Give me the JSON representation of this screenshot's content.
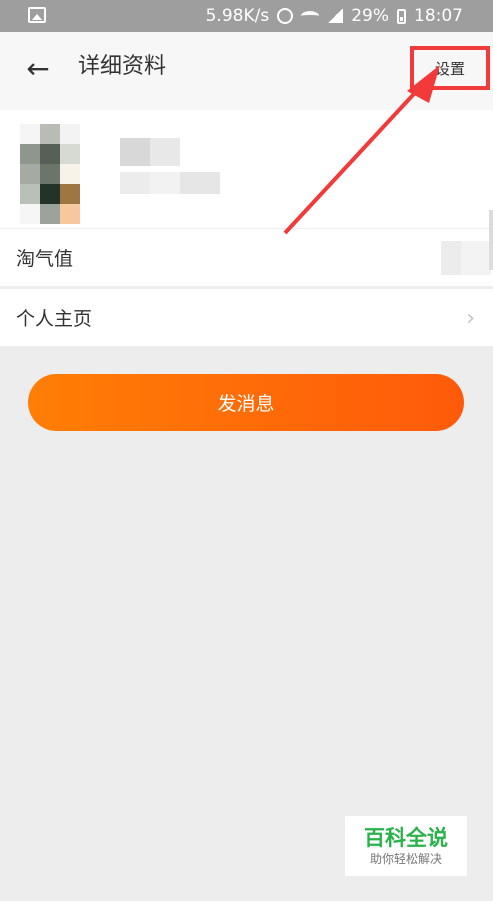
{
  "status_bar": {
    "speed": "5.98K/s",
    "battery": "29%",
    "time": "18:07"
  },
  "navbar": {
    "back_icon": "arrow-left-icon",
    "title": "详细资料",
    "settings_label": "设置"
  },
  "profile": {
    "avatar_icon": "blurred-avatar"
  },
  "rows": {
    "taoqi_label": "淘气值",
    "homepage_label": "个人主页"
  },
  "actions": {
    "send_message_label": "发消息"
  },
  "watermark": {
    "title": "百科全说",
    "subtitle": "助你轻松解决"
  },
  "colors": {
    "accent_start": "#ff7e06",
    "accent_end": "#ff5a0a",
    "annotation_red": "#f23a3a",
    "watermark_green": "#2ab24a"
  }
}
